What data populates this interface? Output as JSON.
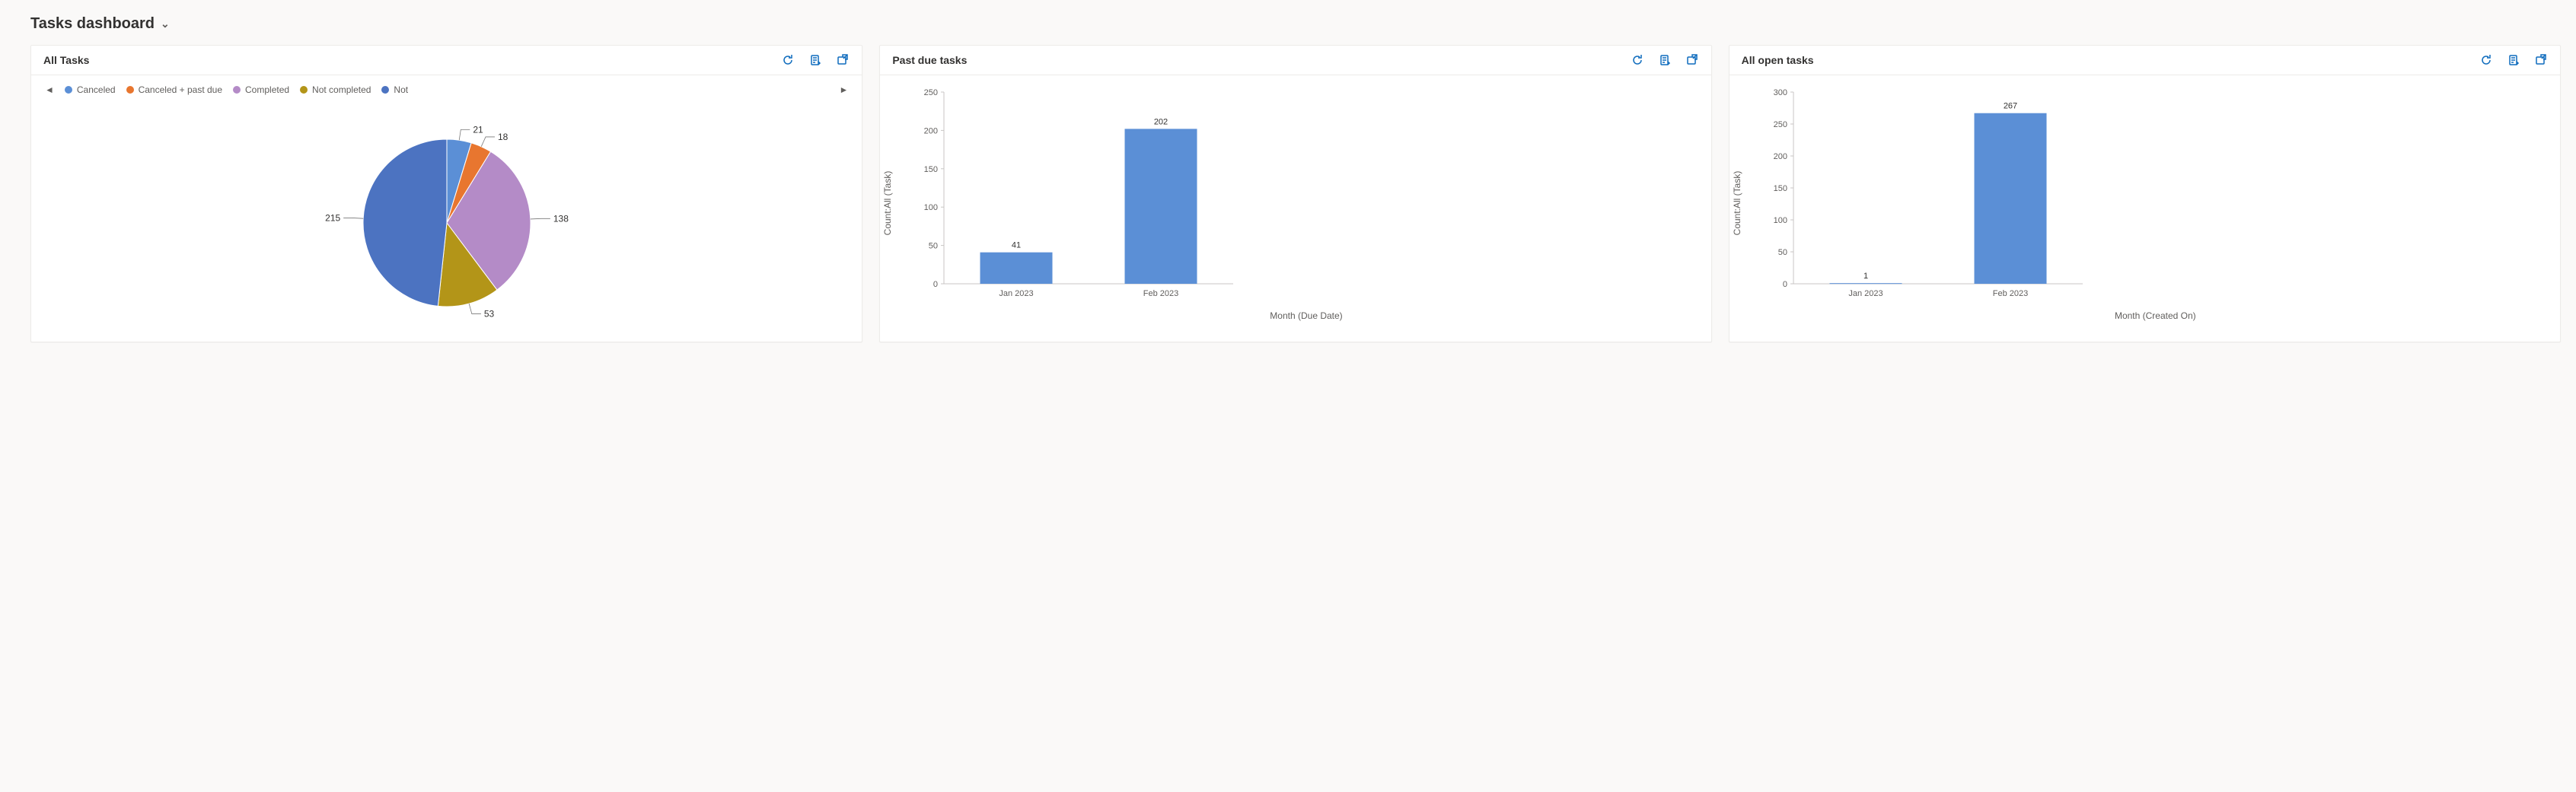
{
  "header": {
    "title": "Tasks dashboard"
  },
  "colors": {
    "blue": "#5b8fd6",
    "orange": "#e8762f",
    "purple": "#b48bc7",
    "olive": "#b39518",
    "darkblue": "#4c73c1",
    "axis": "#c8c6c4",
    "text": "#323130"
  },
  "cards": {
    "allTasks": {
      "title": "All Tasks"
    },
    "pastDue": {
      "title": "Past due tasks"
    },
    "openTasks": {
      "title": "All open tasks"
    }
  },
  "legend": {
    "items": [
      {
        "label": "Canceled",
        "colorKey": "blue"
      },
      {
        "label": "Canceled + past due",
        "colorKey": "orange"
      },
      {
        "label": "Completed",
        "colorKey": "purple"
      },
      {
        "label": "Not completed",
        "colorKey": "olive"
      },
      {
        "label": "Not",
        "colorKey": "darkblue"
      }
    ]
  },
  "chart_data": [
    {
      "id": "allTasksPie",
      "type": "pie",
      "title": "All Tasks",
      "series": [
        {
          "name": "Canceled",
          "value": 21,
          "colorKey": "blue"
        },
        {
          "name": "Canceled + past due",
          "value": 18,
          "colorKey": "orange"
        },
        {
          "name": "Completed",
          "value": 138,
          "colorKey": "purple"
        },
        {
          "name": "Not completed",
          "value": 53,
          "colorKey": "olive"
        },
        {
          "name": "Not",
          "value": 215,
          "colorKey": "darkblue"
        }
      ]
    },
    {
      "id": "pastDueBar",
      "type": "bar",
      "title": "Past due tasks",
      "xlabel": "Month (Due Date)",
      "ylabel": "Count:All (Task)",
      "ylim": [
        0,
        250
      ],
      "ystep": 50,
      "categories": [
        "Jan 2023",
        "Feb 2023"
      ],
      "values": [
        41,
        202
      ]
    },
    {
      "id": "openTasksBar",
      "type": "bar",
      "title": "All open tasks",
      "xlabel": "Month (Created On)",
      "ylabel": "Count:All (Task)",
      "ylim": [
        0,
        300
      ],
      "ystep": 50,
      "categories": [
        "Jan 2023",
        "Feb 2023"
      ],
      "values": [
        1,
        267
      ]
    }
  ]
}
